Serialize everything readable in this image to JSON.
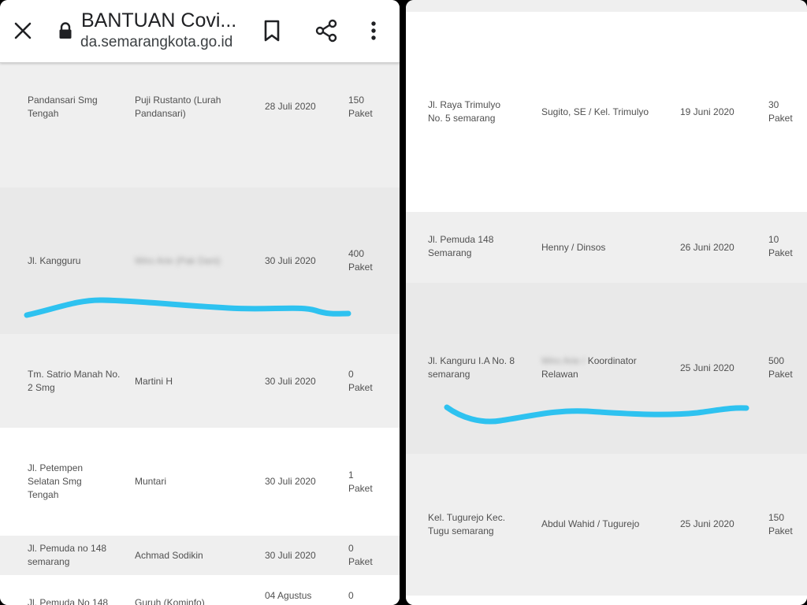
{
  "colors": {
    "scribble": "#2ec2f0",
    "row_gray": "#efefef",
    "row_white": "#ffffff"
  },
  "browser": {
    "title": "BANTUAN Covi...",
    "url": "da.semarangkota.go.id",
    "icons": [
      "close-icon",
      "lock-icon",
      "bookmark-icon",
      "share-icon",
      "more-vert-icon"
    ]
  },
  "left_rows": [
    {
      "address": "Pandansari Smg Tengah",
      "recipient": "Puji Rustanto (Lurah Pandansari)",
      "date": "28 Juli 2020",
      "amount": "150 Paket"
    },
    {
      "address": "Jl. Kangguru",
      "recipient": "Wiro Arie (Pak Dani)",
      "date": "30 Juli 2020",
      "amount": "400 Paket"
    },
    {
      "address": "Tm. Satrio Manah No. 2 Smg",
      "recipient": "Martini H",
      "date": "30 Juli 2020",
      "amount": "0 Paket"
    },
    {
      "address": "Jl. Petempen Selatan Smg Tengah",
      "recipient": "Muntari",
      "date": "30 Juli 2020",
      "amount": "1 Paket"
    },
    {
      "address": "Jl. Pemuda no 148 semarang",
      "recipient": "Achmad Sodikin",
      "date": "30 Juli 2020",
      "amount": "0 Paket"
    },
    {
      "address": "Jl. Pemuda No 148",
      "recipient": "Guruh (Kominfo)",
      "date": "04 Agustus",
      "amount": "0"
    }
  ],
  "right_rows": [
    {
      "address": "Jl. Raya Trimulyo No. 5 semarang",
      "recipient": "Sugito, SE / Kel. Trimulyo",
      "date": "19 Juni 2020",
      "amount": "30 Paket"
    },
    {
      "address": "Jl. Pemuda 148 Semarang",
      "recipient": "Henny / Dinsos",
      "date": "26 Juni 2020",
      "amount": "10 Paket"
    },
    {
      "address": "Jl. Kanguru I.A No. 8 semarang",
      "recipient_hidden": "Wiro Arie /",
      "recipient": "Koordinator Relawan",
      "date": "25 Juni 2020",
      "amount": "500 Paket"
    },
    {
      "address": "Kel. Tugurejo Kec. Tugu semarang",
      "recipient": "Abdul Wahid / Tugurejo",
      "date": "25 Juni 2020",
      "amount": "150 Paket"
    }
  ]
}
